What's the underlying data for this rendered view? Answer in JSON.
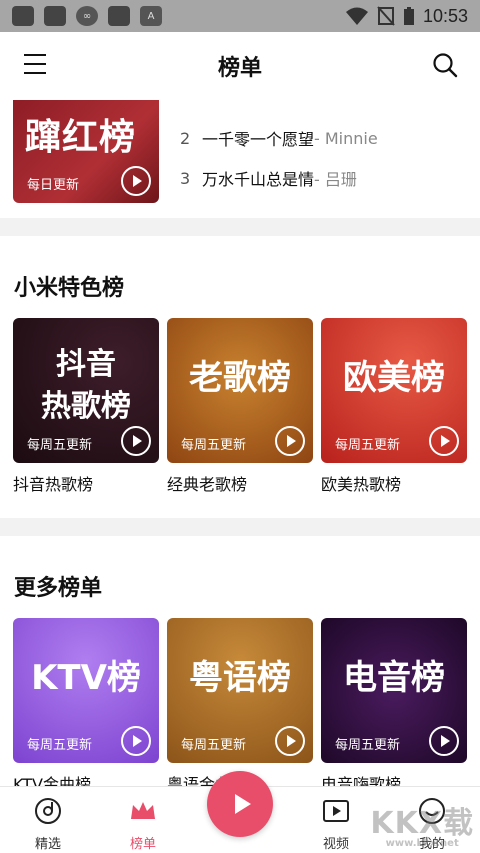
{
  "statusbar": {
    "time": "10:53",
    "icons": [
      "app-icon",
      "app-icon",
      "infinity-icon",
      "app-icon",
      "text-icon",
      "wifi-icon",
      "no-sim-icon",
      "battery-icon"
    ]
  },
  "header": {
    "title": "榜单",
    "menu_icon": "menu-icon",
    "search_icon": "search-icon"
  },
  "top_chart": {
    "cover_title": "蹿红榜",
    "cover_badge": "每日更新",
    "songs": [
      {
        "rank": "2",
        "title": "一千零一个愿望",
        "artist": " - Minnie"
      },
      {
        "rank": "3",
        "title": "万水千山总是情",
        "artist": " - 吕珊"
      }
    ]
  },
  "featured": {
    "title": "小米特色榜",
    "cards": [
      {
        "cover_line1": "抖音",
        "cover_line2": "热歌榜",
        "badge": "每周五更新",
        "label": "抖音热歌榜",
        "color": "#2a1014"
      },
      {
        "cover_line1": "老歌榜",
        "cover_line2": "",
        "badge": "每周五更新",
        "label": "经典老歌榜",
        "color": "#b35b1e"
      },
      {
        "cover_line1": "欧美榜",
        "cover_line2": "",
        "badge": "每周五更新",
        "label": "欧美热歌榜",
        "color": "#d9372c"
      }
    ]
  },
  "more": {
    "title": "更多榜单",
    "cards": [
      {
        "cover_line1": "KTV榜",
        "cover_line2": "",
        "badge": "每周五更新",
        "label": "KTV金曲榜",
        "color": "#9b5de5"
      },
      {
        "cover_line1": "粤语榜",
        "cover_line2": "",
        "badge": "每周五更新",
        "label": "粤语金曲榜",
        "color": "#b5702a"
      },
      {
        "cover_line1": "电音榜",
        "cover_line2": "",
        "badge": "每周五更新",
        "label": "电音嗨歌榜",
        "color": "#2d0d3a"
      }
    ]
  },
  "bottom_nav": {
    "items": [
      {
        "label": "精选",
        "icon": "disc-icon"
      },
      {
        "label": "榜单",
        "icon": "crown-icon"
      },
      {
        "label": "视频",
        "icon": "video-icon"
      },
      {
        "label": "我的",
        "icon": "smile-icon"
      }
    ],
    "active_color": "#e84d6a"
  },
  "watermark": {
    "line1": "KKX载",
    "line2": "www.kkx.net"
  }
}
